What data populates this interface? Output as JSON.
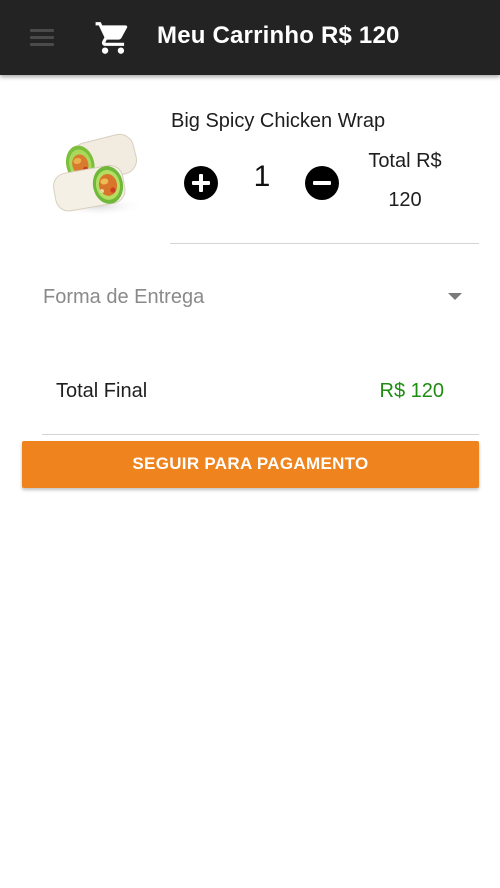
{
  "app_bar": {
    "menu_icon": "hamburger-menu-icon",
    "cart_icon": "shopping-cart-icon",
    "title": "Meu Carrinho R$ 120",
    "background": "#232323"
  },
  "cart_items": [
    {
      "name": "Big Spicy Chicken Wrap",
      "image": "chicken-wrap-food-photo",
      "quantity": "1",
      "total_label": "Total R$",
      "total_value": "120",
      "increase_icon": "plus-circle-icon",
      "decrease_icon": "minus-circle-icon"
    }
  ],
  "delivery": {
    "placeholder": "Forma de Entrega",
    "caret_icon": "dropdown-caret-icon"
  },
  "summary": {
    "label": "Total Final",
    "value": "R$ 120",
    "value_color": "#1f8c12"
  },
  "checkout_button": {
    "label": "SEGUIR PARA PAGAMENTO",
    "color": "#ef831d"
  }
}
